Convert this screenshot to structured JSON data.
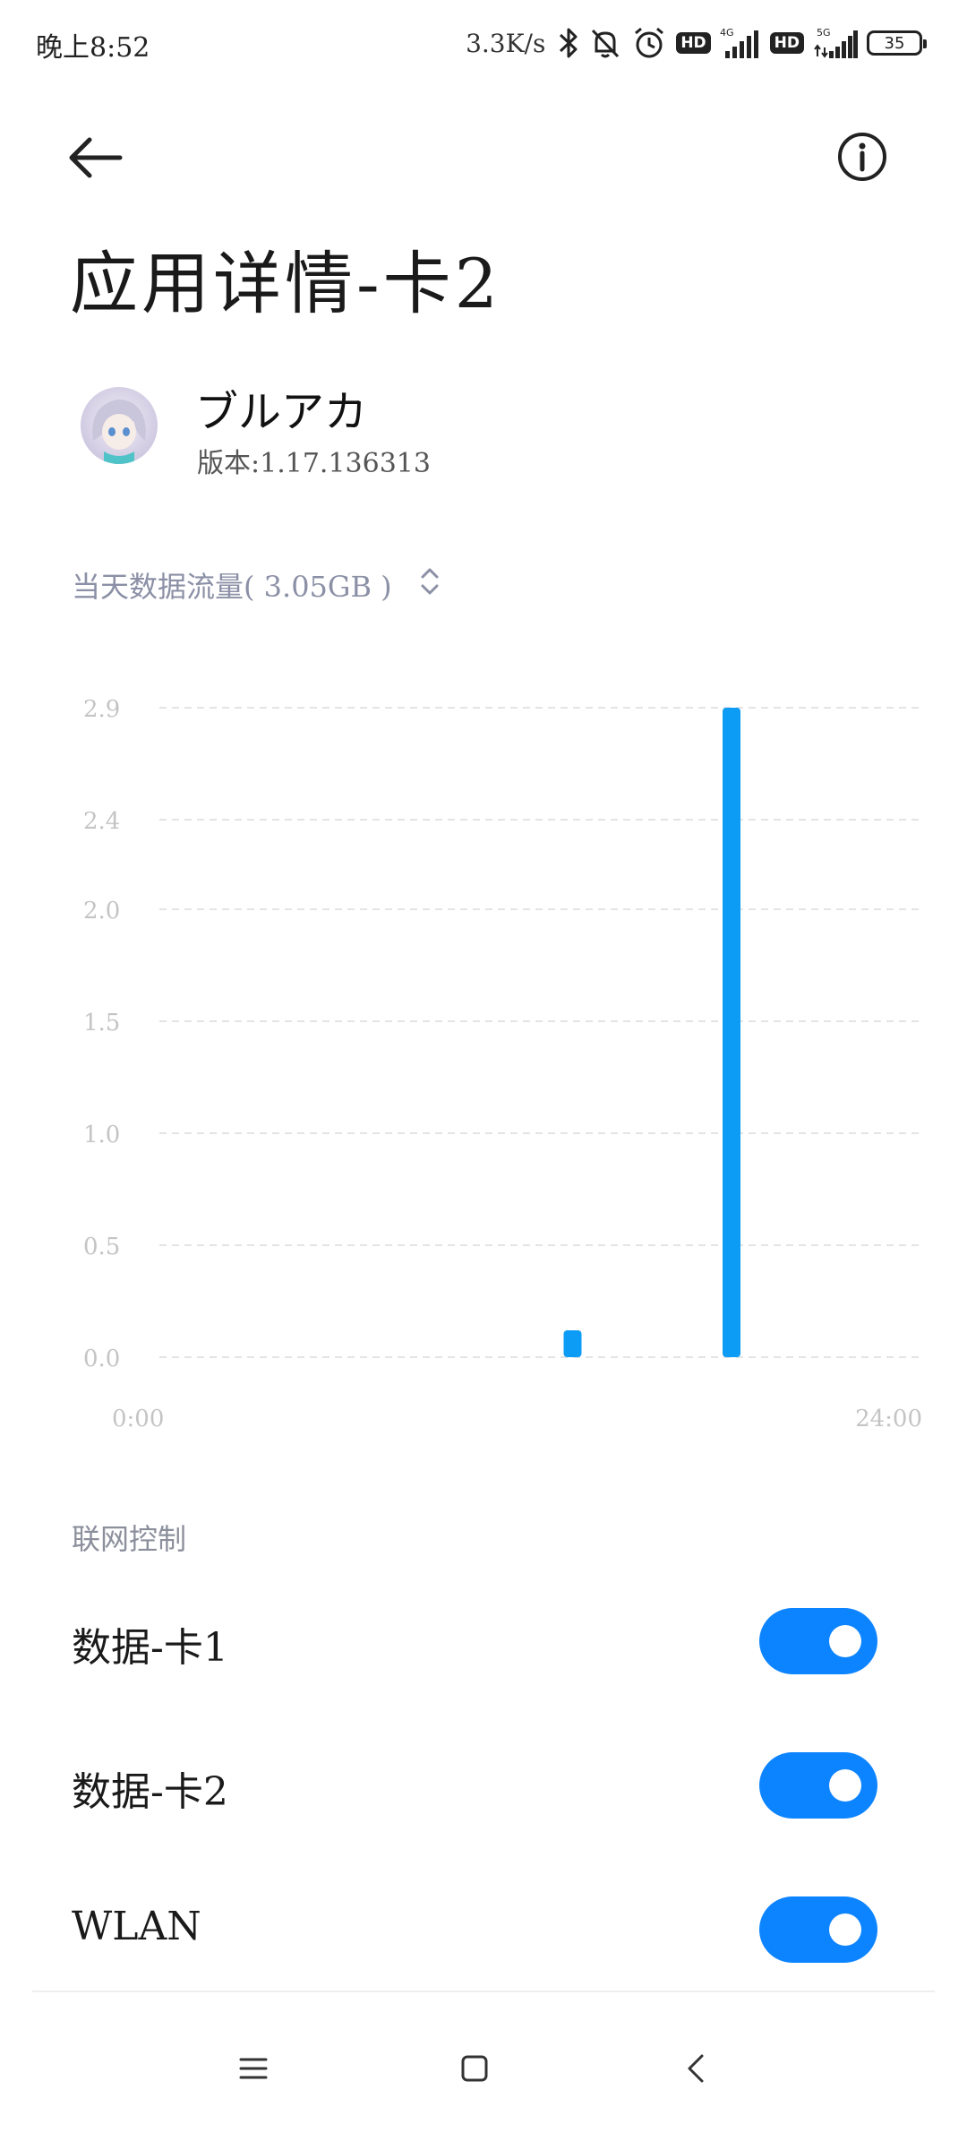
{
  "status_bar": {
    "time": "晚上8:52",
    "net_speed": "3.3K/s",
    "battery": "35",
    "sim1_type": "4G",
    "sim2_type": "5G",
    "hd_label": "HD"
  },
  "header": {
    "back_icon": "arrow-left-icon",
    "info_icon": "info-circle-icon",
    "title": "应用详情-卡2"
  },
  "app": {
    "name": "ブルアカ",
    "version": "版本:1.17.136313"
  },
  "usage": {
    "label": "当天数据流量( 3.05GB )",
    "selector_icon": "chevron-up-down-icon"
  },
  "chart_data": {
    "type": "bar",
    "x_range": [
      "0:00",
      "24:00"
    ],
    "xlabels": [
      "0:00",
      "24:00"
    ],
    "ylabels": [
      "0.0",
      "0.5",
      "1.0",
      "1.5",
      "2.0",
      "2.4",
      "2.9"
    ],
    "ylim": [
      0,
      2.9
    ],
    "unit": "GB",
    "color": "#0d9cf5",
    "bars": [
      {
        "hour": 13,
        "value": 0.12
      },
      {
        "hour": 18,
        "value": 2.9
      }
    ],
    "grid": true
  },
  "network_control": {
    "title": "联网控制",
    "items": [
      {
        "label": "数据-卡1",
        "enabled": true
      },
      {
        "label": "数据-卡2",
        "enabled": true
      },
      {
        "label": "WLAN",
        "enabled": true
      }
    ]
  },
  "colors": {
    "accent": "#0d84ff",
    "bar": "#0d9cf5",
    "muted_text": "#8b90a6"
  },
  "nav": {
    "menu_icon": "menu-icon",
    "home_icon": "home-square-icon",
    "back_icon": "chevron-left-icon"
  }
}
